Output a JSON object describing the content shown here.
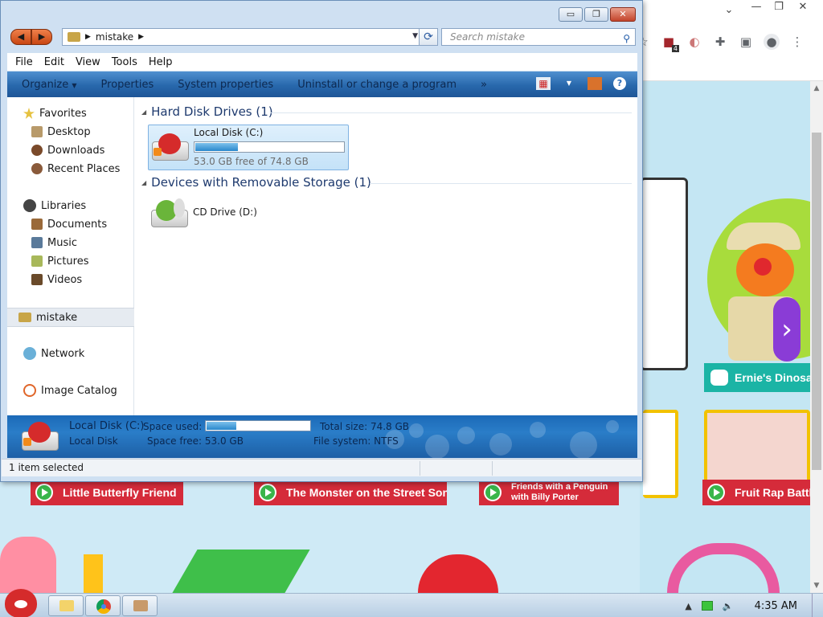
{
  "window": {
    "caption_buttons": {
      "minimize": "▭",
      "maximize": "❐",
      "close": "✕"
    }
  },
  "address": {
    "location_icon": "folder-drive-icon",
    "path": "mistake"
  },
  "search": {
    "placeholder": "Search mistake"
  },
  "menu": [
    "File",
    "Edit",
    "View",
    "Tools",
    "Help"
  ],
  "toolbar": {
    "organize": "Organize",
    "properties": "Properties",
    "system_properties": "System properties",
    "uninstall": "Uninstall or change a program",
    "more": "»"
  },
  "nav": {
    "favorites": "Favorites",
    "desktop": "Desktop",
    "downloads": "Downloads",
    "recent_places": "Recent Places",
    "libraries": "Libraries",
    "documents": "Documents",
    "music": "Music",
    "pictures": "Pictures",
    "videos": "Videos",
    "computer": "mistake",
    "network": "Network",
    "image_catalog": "Image Catalog"
  },
  "groups": {
    "hdd_title": "Hard Disk Drives (1)",
    "removable_title": "Devices with Removable Storage (1)"
  },
  "drives": {
    "c": {
      "name": "Local Disk (C:)",
      "free_text": "53.0 GB free of 74.8 GB",
      "used_fraction": 0.29
    },
    "d": {
      "name": "CD Drive (D:)"
    }
  },
  "details": {
    "name": "Local Disk (C:)",
    "type": "Local Disk",
    "space_used_label": "Space used:",
    "space_free": "Space free: 53.0 GB",
    "total_size": "Total size: 74.8 GB",
    "file_system": "File system: NTFS"
  },
  "status": {
    "selection": "1 item selected"
  },
  "browser_page": {
    "cards": [
      "Little Butterfly Friend",
      "The Monster on the Street Song",
      "Friends with a Penguin with Billy Porter",
      "Fruit Rap Battle"
    ],
    "ernie": "Ernie's Dinosa",
    "extensions_badge": "4"
  },
  "taskbar": {
    "clock": "4:35 AM"
  },
  "colors": {
    "toolbar_blue": "#2868ac",
    "card_red": "#d52b3a",
    "card_yellow": "#f2c200",
    "ernie_teal": "#1bb4a5",
    "next_purple": "#8a3cd6"
  }
}
